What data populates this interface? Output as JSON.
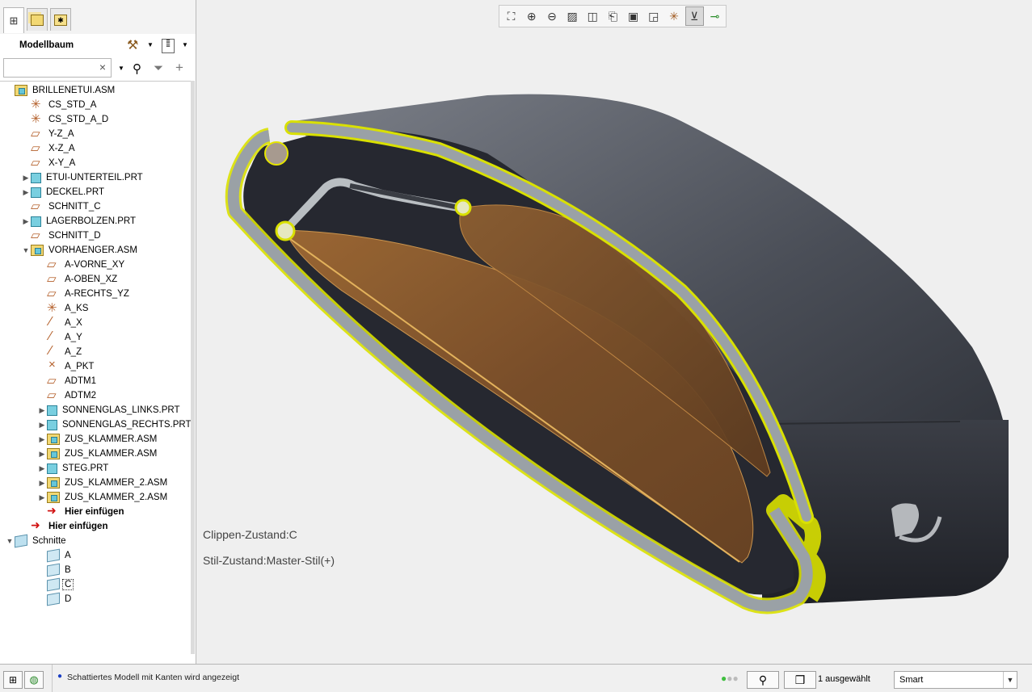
{
  "panel": {
    "title": "Modellbaum",
    "tabs": [
      "model-tree",
      "layers",
      "favorites"
    ],
    "search": {
      "value": "",
      "placeholder": ""
    }
  },
  "tree": [
    {
      "label": "BRILLENETUI.ASM",
      "icon": "assembly-icon",
      "level": 0,
      "expander": ""
    },
    {
      "label": "CS_STD_A",
      "icon": "csys-icon",
      "level": 1,
      "expander": ""
    },
    {
      "label": "CS_STD_A_D",
      "icon": "csys-icon",
      "level": 1,
      "expander": ""
    },
    {
      "label": "Y-Z_A",
      "icon": "datum-plane-icon",
      "level": 1,
      "expander": ""
    },
    {
      "label": "X-Z_A",
      "icon": "datum-plane-icon",
      "level": 1,
      "expander": ""
    },
    {
      "label": "X-Y_A",
      "icon": "datum-plane-icon",
      "level": 1,
      "expander": ""
    },
    {
      "label": "ETUI-UNTERTEIL.PRT",
      "icon": "part-icon",
      "level": 1,
      "expander": "▶"
    },
    {
      "label": "DECKEL.PRT",
      "icon": "part-icon",
      "level": 1,
      "expander": "▶"
    },
    {
      "label": "SCHNITT_C",
      "icon": "datum-plane-icon",
      "level": 1,
      "expander": ""
    },
    {
      "label": "LAGERBOLZEN.PRT",
      "icon": "part-icon",
      "level": 1,
      "expander": "▶"
    },
    {
      "label": "SCHNITT_D",
      "icon": "datum-plane-icon",
      "level": 1,
      "expander": ""
    },
    {
      "label": "VORHAENGER.ASM",
      "icon": "assembly-icon",
      "level": 1,
      "expander": "▼"
    },
    {
      "label": "A-VORNE_XY",
      "icon": "datum-plane-icon",
      "level": 2,
      "expander": ""
    },
    {
      "label": "A-OBEN_XZ",
      "icon": "datum-plane-icon",
      "level": 2,
      "expander": ""
    },
    {
      "label": "A-RECHTS_YZ",
      "icon": "datum-plane-icon",
      "level": 2,
      "expander": ""
    },
    {
      "label": "A_KS",
      "icon": "csys-icon",
      "level": 2,
      "expander": ""
    },
    {
      "label": "A_X",
      "icon": "datum-axis-icon",
      "level": 2,
      "expander": ""
    },
    {
      "label": "A_Y",
      "icon": "datum-axis-icon",
      "level": 2,
      "expander": ""
    },
    {
      "label": "A_Z",
      "icon": "datum-axis-icon",
      "level": 2,
      "expander": ""
    },
    {
      "label": "A_PKT",
      "icon": "datum-point-icon",
      "level": 2,
      "expander": ""
    },
    {
      "label": "ADTM1",
      "icon": "datum-plane-icon",
      "level": 2,
      "expander": ""
    },
    {
      "label": "ADTM2",
      "icon": "datum-plane-icon",
      "level": 2,
      "expander": ""
    },
    {
      "label": "SONNENGLAS_LINKS.PRT",
      "icon": "part-icon",
      "level": 2,
      "expander": "▶"
    },
    {
      "label": "SONNENGLAS_RECHTS.PRT",
      "icon": "part-icon",
      "level": 2,
      "expander": "▶"
    },
    {
      "label": "ZUS_KLAMMER.ASM",
      "icon": "assembly-icon",
      "level": 2,
      "expander": "▶"
    },
    {
      "label": "ZUS_KLAMMER.ASM",
      "icon": "assembly-icon",
      "level": 2,
      "expander": "▶"
    },
    {
      "label": "STEG.PRT",
      "icon": "part-icon",
      "level": 2,
      "expander": "▶"
    },
    {
      "label": "ZUS_KLAMMER_2.ASM",
      "icon": "assembly-icon",
      "level": 2,
      "expander": "▶"
    },
    {
      "label": "ZUS_KLAMMER_2.ASM",
      "icon": "assembly-icon",
      "level": 2,
      "expander": "▶"
    },
    {
      "label": "Hier einfügen",
      "icon": "insert-here-icon",
      "level": 2,
      "expander": ""
    },
    {
      "label": "Hier einfügen",
      "icon": "insert-here-icon",
      "level": 1,
      "expander": ""
    },
    {
      "label": "Schnitte",
      "icon": "sections-icon",
      "level": 0,
      "expander": "▼"
    },
    {
      "label": "A",
      "icon": "section-icon",
      "level": 2,
      "expander": ""
    },
    {
      "label": "B",
      "icon": "section-icon",
      "level": 2,
      "expander": ""
    },
    {
      "label": "C",
      "icon": "section-active-icon",
      "level": 2,
      "expander": "",
      "selected": true
    },
    {
      "label": "D",
      "icon": "section-icon",
      "level": 2,
      "expander": ""
    }
  ],
  "viewport": {
    "toolbar": [
      "refit-icon",
      "zoom-in-icon",
      "zoom-out-icon",
      "repaint-icon",
      "display-style-icon",
      "saved-views-icon",
      "view-manager-icon",
      "perspective-icon",
      "datum-display-icon",
      "annotation-display-icon",
      "spin-center-icon"
    ],
    "active_tool": "annotation-display-icon",
    "clip_state": "Clippen-Zustand:C",
    "style_state": "Stil-Zustand:Master-Stil(+)"
  },
  "status": {
    "message": "Schattiertes Modell mit Kanten wird angezeigt",
    "selected": "1 ausgewählt",
    "filter": "Smart"
  }
}
